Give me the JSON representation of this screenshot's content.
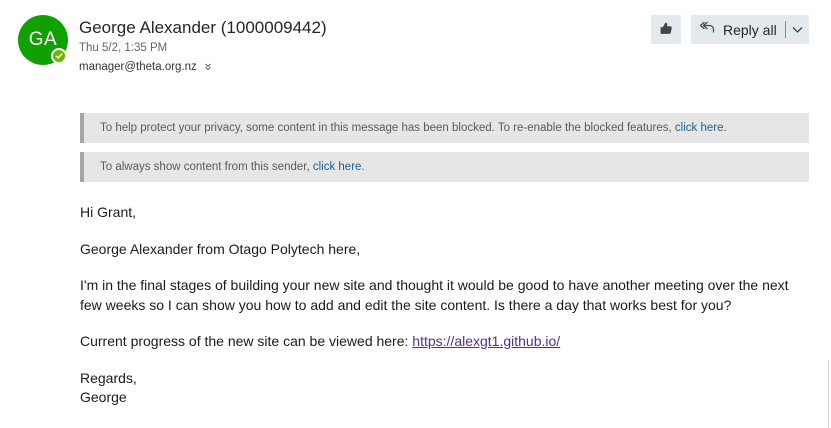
{
  "sender": {
    "initials": "GA",
    "avatar_color": "#10a000",
    "presence_color": "#6bb700",
    "name": "George Alexander (1000009442)",
    "date": "Thu 5/2, 1:35 PM",
    "address": "manager@theta.org.nz"
  },
  "toolbar": {
    "like_icon": "thumbs-up-icon",
    "reply_all_label": "Reply all",
    "reply_icon": "reply-all-icon",
    "dropdown_icon": "chevron-down-icon"
  },
  "notices": {
    "privacy_text": "To help protect your privacy, some content in this message has been blocked. To re-enable the blocked features, ",
    "privacy_link": "click here.",
    "sender_text": "To always show content from this sender, ",
    "sender_link": "click here."
  },
  "message": {
    "greeting": "Hi Grant,",
    "intro": "George Alexander from Otago Polytech here,",
    "paragraph": "I'm in the final stages of building your new site and thought it would be good to have another meeting over the next few weeks so I can show you how to add and edit the site content. Is there a day that works best for you?",
    "progress_text": "Current progress of the new site can be viewed here: ",
    "progress_link": "https://alexgt1.github.io/",
    "signoff": "Regards,",
    "signature": "George"
  }
}
